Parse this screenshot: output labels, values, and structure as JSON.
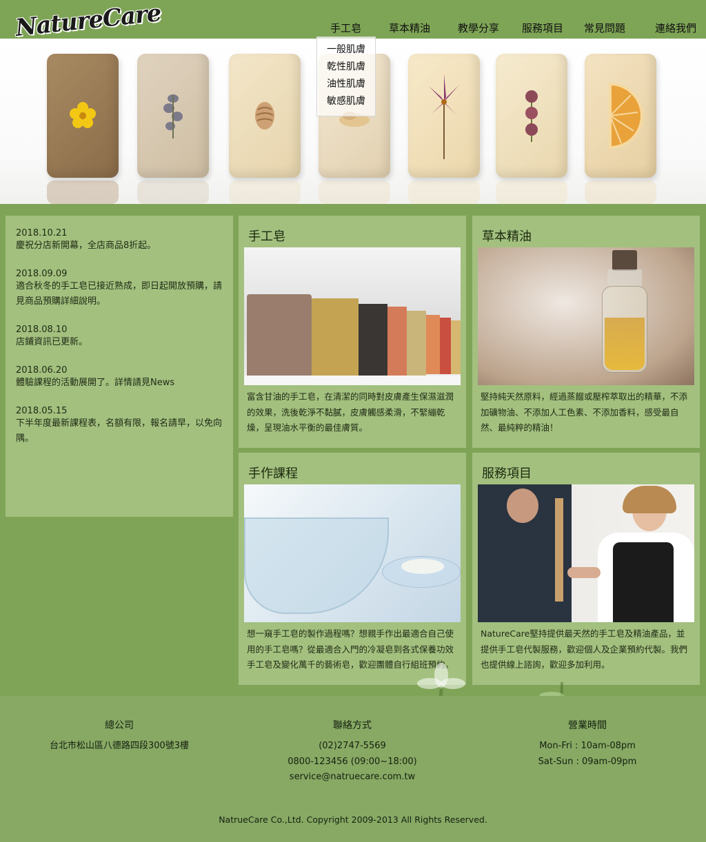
{
  "brand": {
    "logo_text": "NatureCare"
  },
  "nav": {
    "items": [
      {
        "label": "手工皂"
      },
      {
        "label": "草本精油"
      },
      {
        "label": "教學分享"
      },
      {
        "label": "服務項目"
      },
      {
        "label": "常見問題"
      },
      {
        "label": "連絡我們"
      }
    ],
    "dropdown": [
      "一般肌膚",
      "乾性肌膚",
      "油性肌膚",
      "敏感肌膚"
    ]
  },
  "news": [
    {
      "date": "2018.10.21",
      "text": "慶祝分店新開幕，全店商品8折起。"
    },
    {
      "date": "2018.09.09",
      "text": "適合秋冬的手工皂已接近熟成，即日起開放預購，請見商品預購詳細說明。"
    },
    {
      "date": "2018.08.10",
      "text": "店鋪資訊已更新。"
    },
    {
      "date": "2018.06.20",
      "text": "體驗課程的活動展開了。詳情請見News"
    },
    {
      "date": "2018.05.15",
      "text": "下半年度最新課程表，名額有限，報名請早，以免向隅。"
    }
  ],
  "cards": [
    {
      "title": "手工皂",
      "desc": "富含甘油的手工皂，在清潔的同時對皮膚產生保濕滋潤的效果，洗後乾淨不黏膩，皮膚觸感柔滑，不緊繃乾燥，呈現油水平衡的最佳膚質。"
    },
    {
      "title": "草本精油",
      "desc": "堅持純天然原料，經過蒸餾或壓榨萃取出的精華，不添加礦物油、不添加人工色素、不添加香料，感受最自然、最純粹的精油！"
    },
    {
      "title": "手作課程",
      "desc": "想一窺手工皂的製作過程嗎？想親手作出最適合自己使用的手工皂嗎？從最適合入門的冷凝皂到各式保養功效手工皂及變化萬千的藝術皂，歡迎團體自行組班預約。"
    },
    {
      "title": "服務項目",
      "desc": "NatureCare堅持提供最天然的手工皂及精油產品，並提供手工皂代製服務，歡迎個人及企業預約代製。我們也提供線上諮詢，歡迎多加利用。"
    }
  ],
  "footer": {
    "hq": {
      "title": "總公司",
      "lines": [
        "台北市松山區八德路四段300號3樓"
      ]
    },
    "contact": {
      "title": "聯絡方式",
      "lines": [
        "(02)2747-5569",
        "0800-123456 (09:00~18:00)",
        "service@natruecare.com.tw"
      ]
    },
    "hours": {
      "title": "營業時間",
      "lines": [
        "Mon-Fri : 10am-08pm",
        "Sat-Sun : 09am-09pm"
      ]
    },
    "copyright": "NatrueCare Co.,Ltd. Copyright 2009-2013 All Rights Reserved."
  },
  "colors": {
    "page_bg": "#7fa457",
    "panel_bg": "#afca8c",
    "footer_bg": "#87a964"
  },
  "icons": [
    "flower-decoration",
    "plant-decoration"
  ]
}
